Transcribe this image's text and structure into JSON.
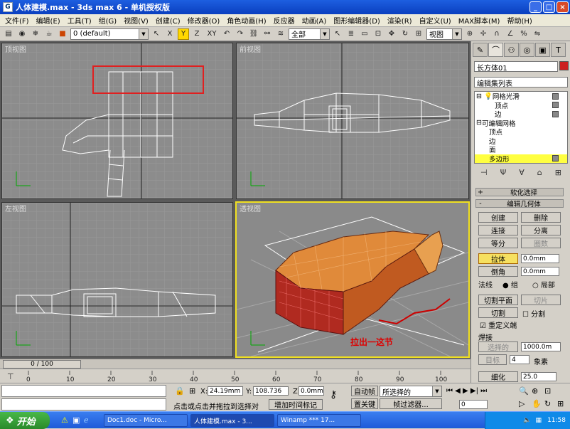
{
  "window": {
    "title": "人体建模.max - 3ds max 6 - 单机授权版",
    "icon": "3ds-max-icon",
    "buttons": [
      "_",
      "□",
      "×"
    ]
  },
  "menu": [
    "文件(F)",
    "编辑(E)",
    "工具(T)",
    "组(G)",
    "视图(V)",
    "创建(C)",
    "修改器(O)",
    "角色动画(H)",
    "反应器",
    "动画(A)",
    "图形编辑器(D)",
    "渲染(R)",
    "自定义(U)",
    "MAX脚本(M)",
    "帮助(H)"
  ],
  "toolbar": {
    "layer": "0 (default)",
    "axes": [
      "X",
      "Y",
      "Z",
      "XY"
    ],
    "active_axis": "Y",
    "selection_filter": "全部",
    "ref_coord": "视图"
  },
  "viewports": {
    "top": "顶视图",
    "front": "前视图",
    "left": "左视图",
    "perspective": "透视图",
    "annotation": "拉出一这节"
  },
  "panel": {
    "tabs": [
      "create-icon",
      "modify-icon",
      "hierarchy-icon",
      "motion-icon",
      "display-icon",
      "utilities-icon"
    ],
    "object_name": "长方体01",
    "object_color": "#cc2020",
    "modifier_list": "编辑集列表",
    "stack": [
      {
        "label": "网格光滑",
        "indent": 0,
        "swatch": true
      },
      {
        "label": "顶点",
        "indent": 2,
        "swatch": false
      },
      {
        "label": "边",
        "indent": 2,
        "swatch": true
      },
      {
        "label": "可编辑网格",
        "indent": 0,
        "swatch": false
      },
      {
        "label": "顶点",
        "indent": 1,
        "swatch": false
      },
      {
        "label": "边",
        "indent": 1,
        "swatch": false
      },
      {
        "label": "面",
        "indent": 1,
        "swatch": false
      },
      {
        "label": "多边形",
        "indent": 1,
        "swatch": true,
        "selected": true
      }
    ],
    "rollouts": {
      "soft": "软化选择",
      "edit_geo": "编辑几何体",
      "weld": "焊接"
    },
    "buttons": {
      "create": "创建",
      "delete": "删除",
      "attach": "连接",
      "detach": "分离",
      "divide": "等分",
      "turn": "圈数",
      "extrude": "拉体",
      "chamfer": "倒角",
      "cut_plane": "切割平面",
      "slice": "切片",
      "cut": "切割",
      "select_open": "选择的",
      "target": "目标",
      "tessellate": "细化"
    },
    "spinners": {
      "extrude_val": "0.0mm",
      "chamfer_val": "0.0mm",
      "weld_sel": "1000.0m",
      "weld_target": "4",
      "weld_unit": "象素",
      "tess_val": "25.0"
    },
    "labels": {
      "normal": "法线",
      "group": "组",
      "local": "局部",
      "split": "分割",
      "refine_ends": "重定义端"
    }
  },
  "timeline": {
    "frame": "0 / 100",
    "ticks": [
      "0",
      "10",
      "20",
      "30",
      "40",
      "50",
      "60",
      "70",
      "80",
      "90",
      "100"
    ]
  },
  "status": {
    "x": "24.19mm",
    "y": "108.736",
    "z": "0.0mm",
    "x_label": "X:",
    "y_label": "Y:",
    "z_label": "Z:",
    "auto_key": "自动帧",
    "set_key": "置关键",
    "selected": "所选择的",
    "key_filters": "帧过滤器...",
    "prompt": "点击或点击并拖拉到选择对",
    "add_tag": "增加时间标记",
    "frame_field": "0"
  },
  "taskbar": {
    "start": "开始",
    "tasks": [
      "Doc1.doc - Micro...",
      "人体建模.max - 3...",
      "Winamp *** 17..."
    ],
    "active_task": 1,
    "time": "11:58"
  }
}
